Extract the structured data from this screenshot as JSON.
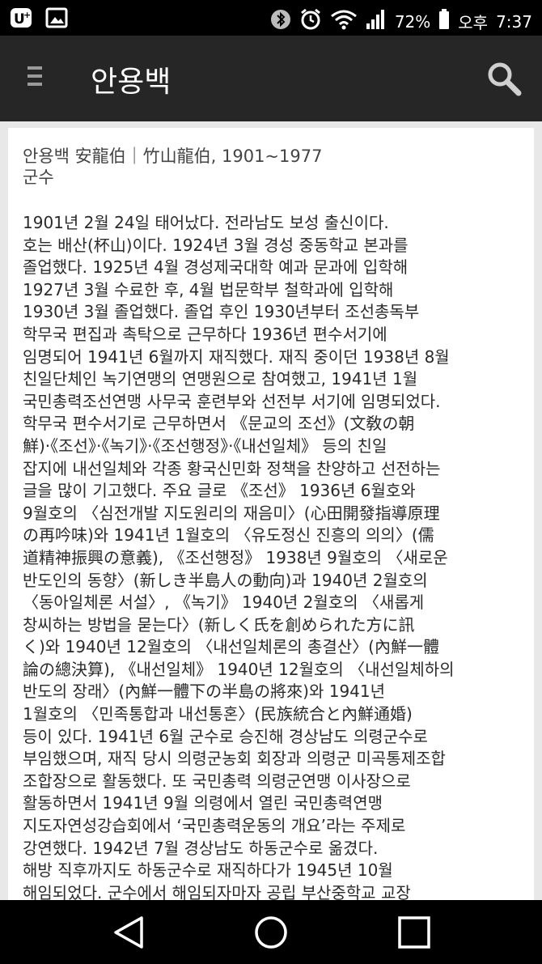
{
  "status_bar": {
    "battery": "72%",
    "ampm": "오후",
    "time": "7:37",
    "icons": [
      "u-plus-icon",
      "gallery-icon",
      "bluetooth-icon",
      "alarm-icon",
      "wifi-icon",
      "signal-icon",
      "battery-icon"
    ]
  },
  "app_bar": {
    "title": "안용백",
    "menu_icon": "menu-icon",
    "search_icon": "search-icon"
  },
  "article": {
    "name_line": "안용백 安龍伯｜竹山龍伯, 1901~1977",
    "role_line": "군수",
    "lines": [
      "1901년 2월 24일 태어났다. 전라남도 보성 출신이다.",
      "호는 배산(杯山)이다. 1924년 3월 경성 중동학교 본과를",
      "졸업했다. 1925년 4월 경성제국대학 예과 문과에 입학해",
      "1927년 3월 수료한 후, 4월 법문학부 철학과에 입학해",
      "1930년 3월 졸업했다. 졸업 후인 1930년부터 조선총독부",
      "학무국 편집과 촉탁으로 근무하다 1936년 편수서기에",
      "임명되어 1941년 6월까지 재직했다. 재직 중이던 1938년 8월",
      "친일단체인 녹기연맹의 연맹원으로 참여했고, 1941년 1월",
      "국민총력조선연맹 사무국 훈련부와 선전부 서기에 임명되었다.",
      "학무국 편수서기로 근무하면서 《문교의 조선》(文敎の朝",
      "鮮)·《조선》·《녹기》·《조선행정》·《내선일체》 등의 친일",
      "잡지에 내선일체와 각종 황국신민화 정책을 찬양하고 선전하는",
      "글을 많이 기고했다. 주요 글로 《조선》 1936년 6월호와",
      "9월호의 〈심전개발 지도원리의 재음미〉(心田開發指導原理",
      "の再吟味)와 1941년 1월호의 〈유도정신 진흥의 의의〉(儒",
      "道精神振興の意義), 《조선행정》 1938년 9월호의 〈새로운",
      "반도인의 동향〉(新しき半島人の動向)과 1940년 2월호의",
      "〈동아일체론 서설〉, 《녹기》 1940년 2월호의 〈새롭게",
      "창씨하는 방법을 묻는다〉(新しく氏を創められた方に訊",
      "く)와 1940년 12월호의 〈내선일체론의 총결산〉(內鮮一體",
      "論の總決算), 《내선일체》 1940년 12월호의 〈내선일체하의",
      "반도의 장래〉(內鮮一體下の半島の將來)와 1941년",
      "1월호의 〈민족통합과 내선통혼〉(民族統合と內鮮通婚)",
      "등이 있다. 1941년 6월 군수로 승진해 경상남도 의령군수로",
      "부임했으며, 재직 당시 의령군농회 회장과 의령군 미곡통제조합",
      "조합장으로 활동했다. 또 국민총력 의령군연맹 이사장으로",
      "활동하면서 1941년 9월 의령에서 열린 국민총력연맹",
      "지도자연성강습회에서 ‘국민총력운동의 개요’라는 주제로",
      "강연했다. 1942년 7월 경상남도 하동군수로 옮겼다.",
      "해방 직후까지도 하동군수로 재직하다가 1945년 10월",
      "해임되었다. 군수에서 해임되자마자 공립 부산중학교 교장"
    ]
  },
  "nav_bar": {
    "icons": [
      "back-icon",
      "home-icon",
      "recents-icon"
    ]
  }
}
